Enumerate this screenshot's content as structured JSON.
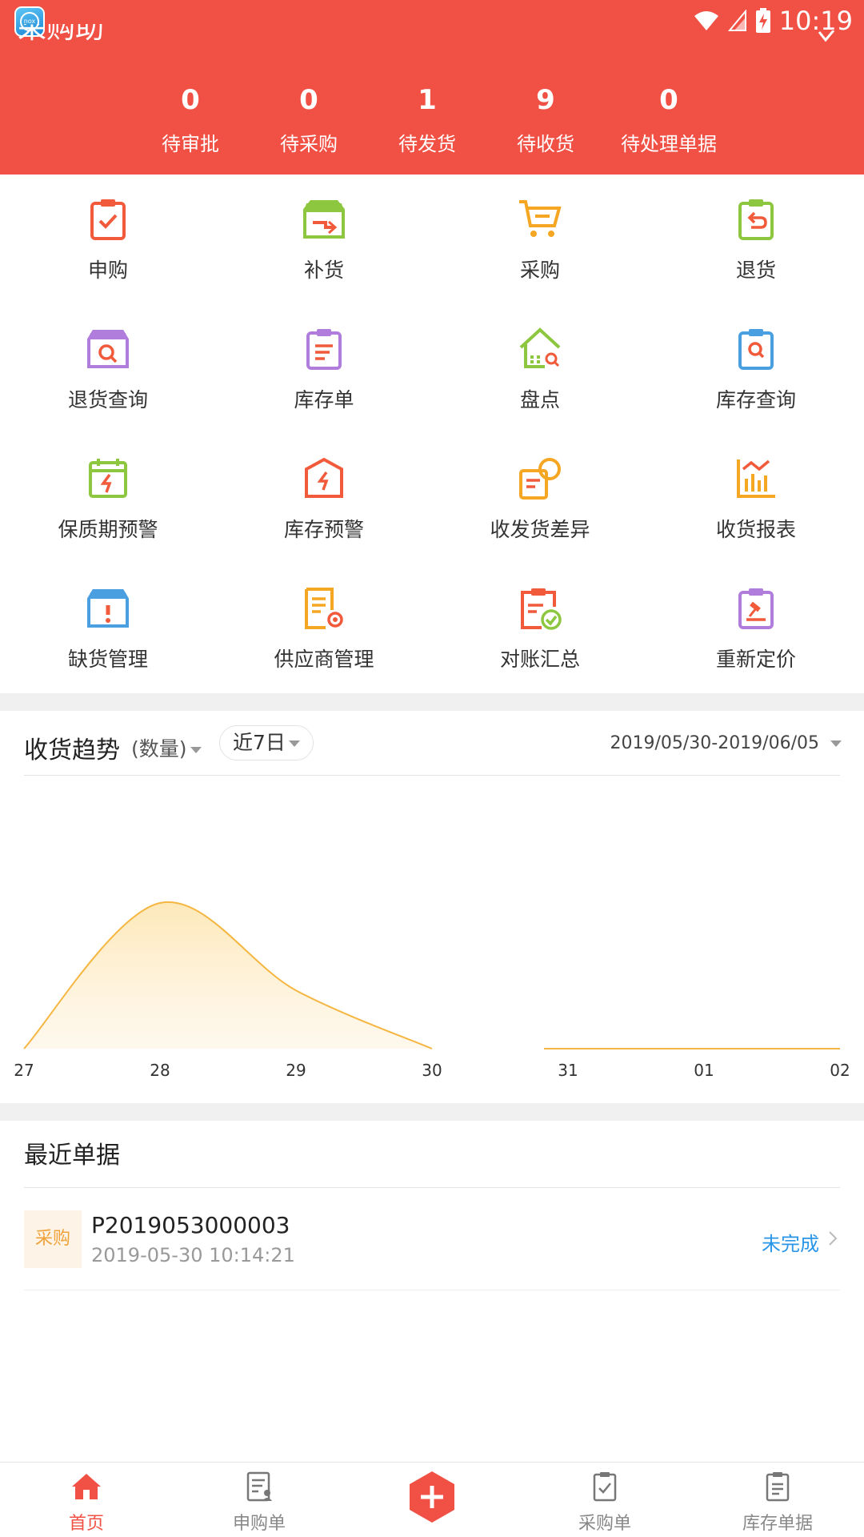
{
  "status_bar": {
    "time": "10:19"
  },
  "stats": [
    {
      "value": "0",
      "label": "待审批"
    },
    {
      "value": "0",
      "label": "待采购"
    },
    {
      "value": "1",
      "label": "待发货"
    },
    {
      "value": "9",
      "label": "待收货"
    },
    {
      "value": "0",
      "label": "待处理单据"
    }
  ],
  "grid": [
    {
      "label": "申购",
      "icon": "clipboard-check-icon",
      "color": "#f15a3a"
    },
    {
      "label": "补货",
      "icon": "box-arrow-icon",
      "color": "#8dc63f"
    },
    {
      "label": "采购",
      "icon": "cart-icon",
      "color": "#f5a623"
    },
    {
      "label": "退货",
      "icon": "return-clipboard-icon",
      "color": "#8dc63f"
    },
    {
      "label": "退货查询",
      "icon": "box-search-icon",
      "color": "#b07ddc"
    },
    {
      "label": "库存单",
      "icon": "list-clipboard-icon",
      "color": "#b07ddc"
    },
    {
      "label": "盘点",
      "icon": "house-search-icon",
      "color": "#8dc63f"
    },
    {
      "label": "库存查询",
      "icon": "clipboard-search-icon",
      "color": "#4a9fe0"
    },
    {
      "label": "保质期预警",
      "icon": "calendar-alert-icon",
      "color": "#8dc63f"
    },
    {
      "label": "库存预警",
      "icon": "hex-alert-icon",
      "color": "#f15a3a"
    },
    {
      "label": "收发货差异",
      "icon": "doc-compare-icon",
      "color": "#f5a623"
    },
    {
      "label": "收货报表",
      "icon": "bar-report-icon",
      "color": "#f5a623"
    },
    {
      "label": "缺货管理",
      "icon": "box-warning-icon",
      "color": "#4a9fe0"
    },
    {
      "label": "供应商管理",
      "icon": "doc-gear-icon",
      "color": "#f5a623"
    },
    {
      "label": "对账汇总",
      "icon": "clipboard-verify-icon",
      "color": "#f15a3a"
    },
    {
      "label": "重新定价",
      "icon": "clipboard-hammer-icon",
      "color": "#b07ddc"
    }
  ],
  "chart_section": {
    "title": "收货趋势",
    "metric": "(数量)",
    "range": "近7日",
    "date_range": "2019/05/30-2019/06/05"
  },
  "chart_data": {
    "type": "area",
    "categories": [
      "27",
      "28",
      "29",
      "30",
      "31",
      "01",
      "02"
    ],
    "values": [
      0,
      1.0,
      0.4,
      0,
      0,
      0,
      0
    ],
    "color": "#f5b642"
  },
  "recent": {
    "title": "最近单据",
    "items": [
      {
        "tag": "采购",
        "number": "P2019053000003",
        "time": "2019-05-30 10:14:21",
        "status": "未完成"
      }
    ]
  },
  "tabs": [
    {
      "label": "首页",
      "icon": "home-icon",
      "active": true
    },
    {
      "label": "申购单",
      "icon": "purchase-request-icon",
      "active": false
    },
    {
      "label": "",
      "icon": "plus-icon",
      "active": false
    },
    {
      "label": "采购单",
      "icon": "purchase-order-icon",
      "active": false
    },
    {
      "label": "库存单据",
      "icon": "inventory-doc-icon",
      "active": false
    }
  ],
  "colors": {
    "brand": "#f15145",
    "link": "#2a96e8",
    "chart": "#f5b642"
  }
}
